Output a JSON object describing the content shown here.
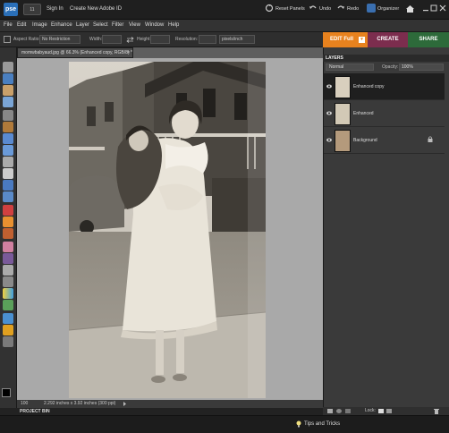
{
  "topbar": {
    "logo": "pse",
    "mode": "11",
    "sign_in": "Sign In",
    "create_id": "Create New Adobe ID",
    "reset_panels": "Reset Panels",
    "undo": "Undo",
    "redo": "Redo",
    "organizer": "Organizer"
  },
  "menu": [
    "File",
    "Edit",
    "Image",
    "Enhance",
    "Layer",
    "Select",
    "Filter",
    "View",
    "Window",
    "Help"
  ],
  "options": {
    "aspect_label": "Aspect Ratio:",
    "aspect_value": "No Restriction",
    "width_label": "Width:",
    "height_label": "Height:",
    "resolution_label": "Resolution:",
    "resolution_unit": "pixels/inch"
  },
  "tabs": {
    "edit": "EDIT Full",
    "create": "CREATE",
    "share": "SHARE"
  },
  "document": {
    "tab_title": "momwbabyaud.jpg @ 66.3% (Enhanced copy, RGB/8) *",
    "zoom": "100",
    "doc_info": "2.292 inches x 3.92 inches (300 ppi)"
  },
  "layers_panel": {
    "title": "LAYERS",
    "blend_mode": "Normal",
    "opacity_label": "Opacity:",
    "opacity_value": "100%",
    "lock_label": "Lock:",
    "layers": [
      {
        "name": "Enhanced copy",
        "selected": true
      },
      {
        "name": "Enhanced",
        "selected": false
      },
      {
        "name": "Background",
        "selected": false,
        "locked": true
      }
    ]
  },
  "project_bin": "PROJECT BIN",
  "tips": "Tips and Tricks",
  "colors": {
    "accent_edit": "#e8821e",
    "create": "#7c2d4e",
    "share": "#2d6a3a"
  }
}
